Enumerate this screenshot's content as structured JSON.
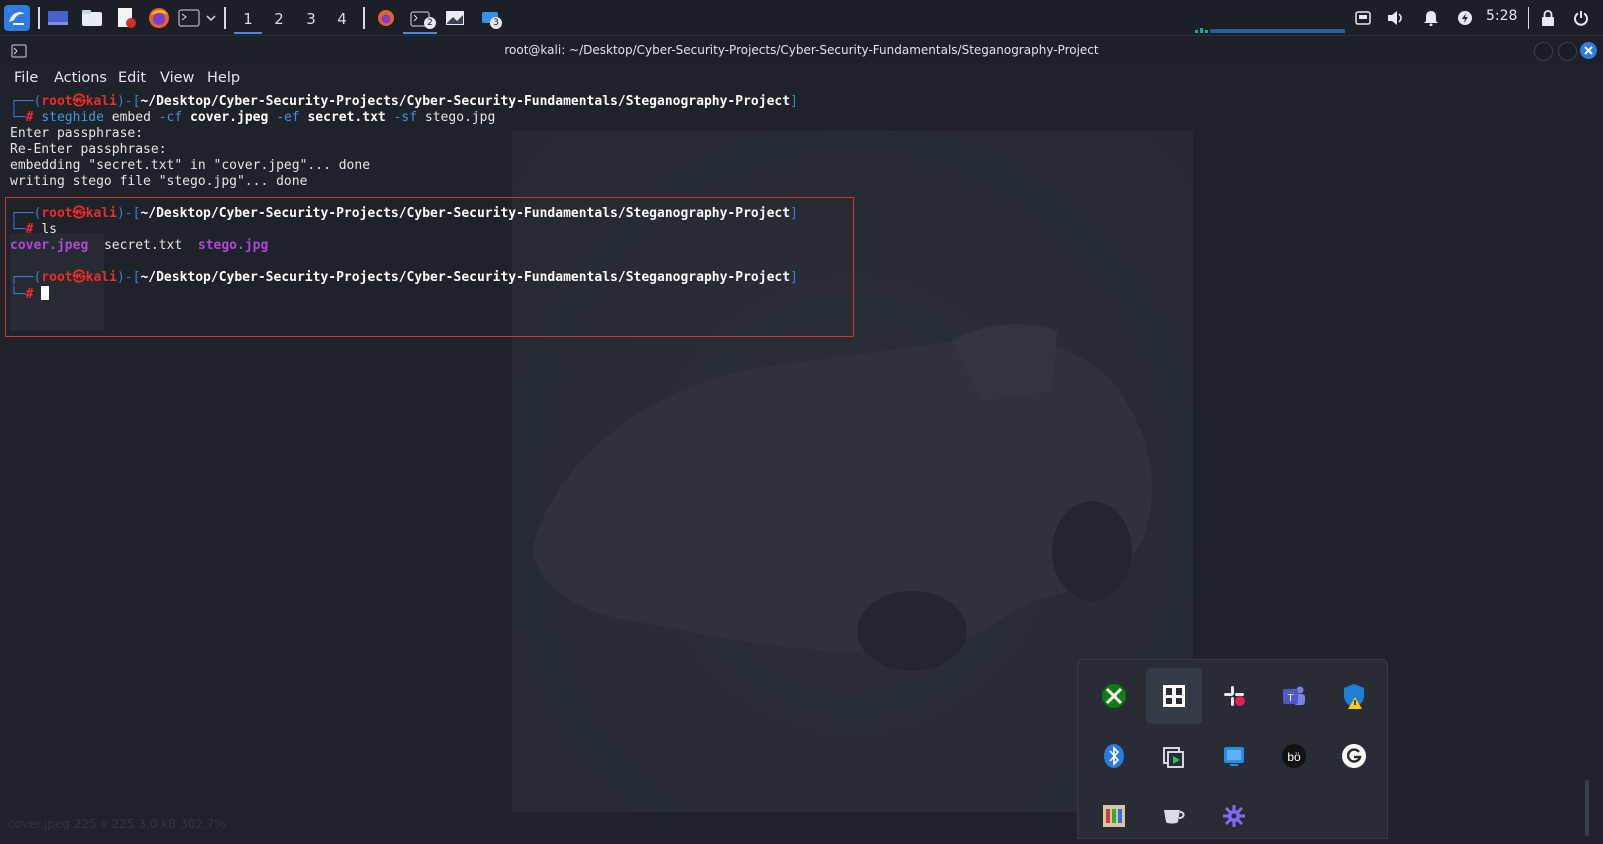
{
  "taskbar": {
    "workspaces": [
      "1",
      "2",
      "3",
      "4"
    ],
    "badges": {
      "terminal": "2",
      "remote": "3"
    },
    "clock": "5:28"
  },
  "window": {
    "title": "root@kali: ~/Desktop/Cyber-Security-Projects/Cyber-Security-Fundamentals/Steganography-Project"
  },
  "menu": [
    "File",
    "Actions",
    "Edit",
    "View",
    "Help"
  ],
  "terminal": {
    "user": "root",
    "at": "㉿",
    "host": "kali",
    "cwd": "~/Desktop/Cyber-Security-Projects/Cyber-Security-Fundamentals/Steganography-Project",
    "prompt_symbol": "#",
    "cmd1": {
      "tool": "steghide",
      "sub": "embed",
      "f1": "-cf",
      "a1": "cover.jpeg",
      "f2": "-ef",
      "a2": "secret.txt",
      "f3": "-sf",
      "a3": "stego.jpg"
    },
    "output1": [
      "Enter passphrase:",
      "Re-Enter passphrase:",
      "embedding \"secret.txt\" in \"cover.jpeg\"... done",
      "writing stego file \"stego.jpg\"... done"
    ],
    "cmd2": "ls",
    "ls_output": [
      "cover.jpeg",
      "secret.txt",
      "stego.jpg"
    ]
  },
  "statusbar": "cover.jpeg 225 x 225   3.0 kB   302.7%",
  "tray": {
    "icons": [
      "xbox-icon",
      "notion-icon",
      "slack-icon",
      "teams-icon",
      "defender-icon",
      "bluetooth-icon",
      "screen-share-icon",
      "windows-app-icon",
      "beats-icon",
      "grammarly-icon",
      "color-picker-icon",
      "coffee-cup-icon",
      "settings-gear-icon"
    ]
  },
  "colors": {
    "accent": "#3b8fe5",
    "prompt_red": "#ef2b2b",
    "highlight": "#d93232",
    "purple": "#b347d9"
  }
}
